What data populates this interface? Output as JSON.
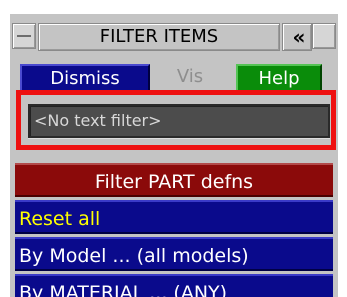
{
  "window": {
    "title": "FILTER ITEMS",
    "collapse_glyph": "«",
    "left_control_icon": "minimize-bar-icon",
    "right_control_icon": "window-square-icon"
  },
  "buttons": {
    "dismiss": "Dismiss",
    "vis": "Vis",
    "help": "Help"
  },
  "text_filter": {
    "value": "<No text filter>"
  },
  "filter_section": {
    "header": "Filter PART defns",
    "items": [
      {
        "label": "Reset all"
      },
      {
        "label": "By Model ... (all models)"
      },
      {
        "label": "By MATERIAL ... (ANY)"
      }
    ]
  },
  "colors": {
    "panel_bg": "#c4c4c4",
    "button_blue": "#0a0a8c",
    "button_green": "#0a8c0a",
    "header_red": "#8b0a0a",
    "reset_text": "#ffff00",
    "highlight_red": "#ee1111",
    "input_bg": "#4c4c4c"
  }
}
